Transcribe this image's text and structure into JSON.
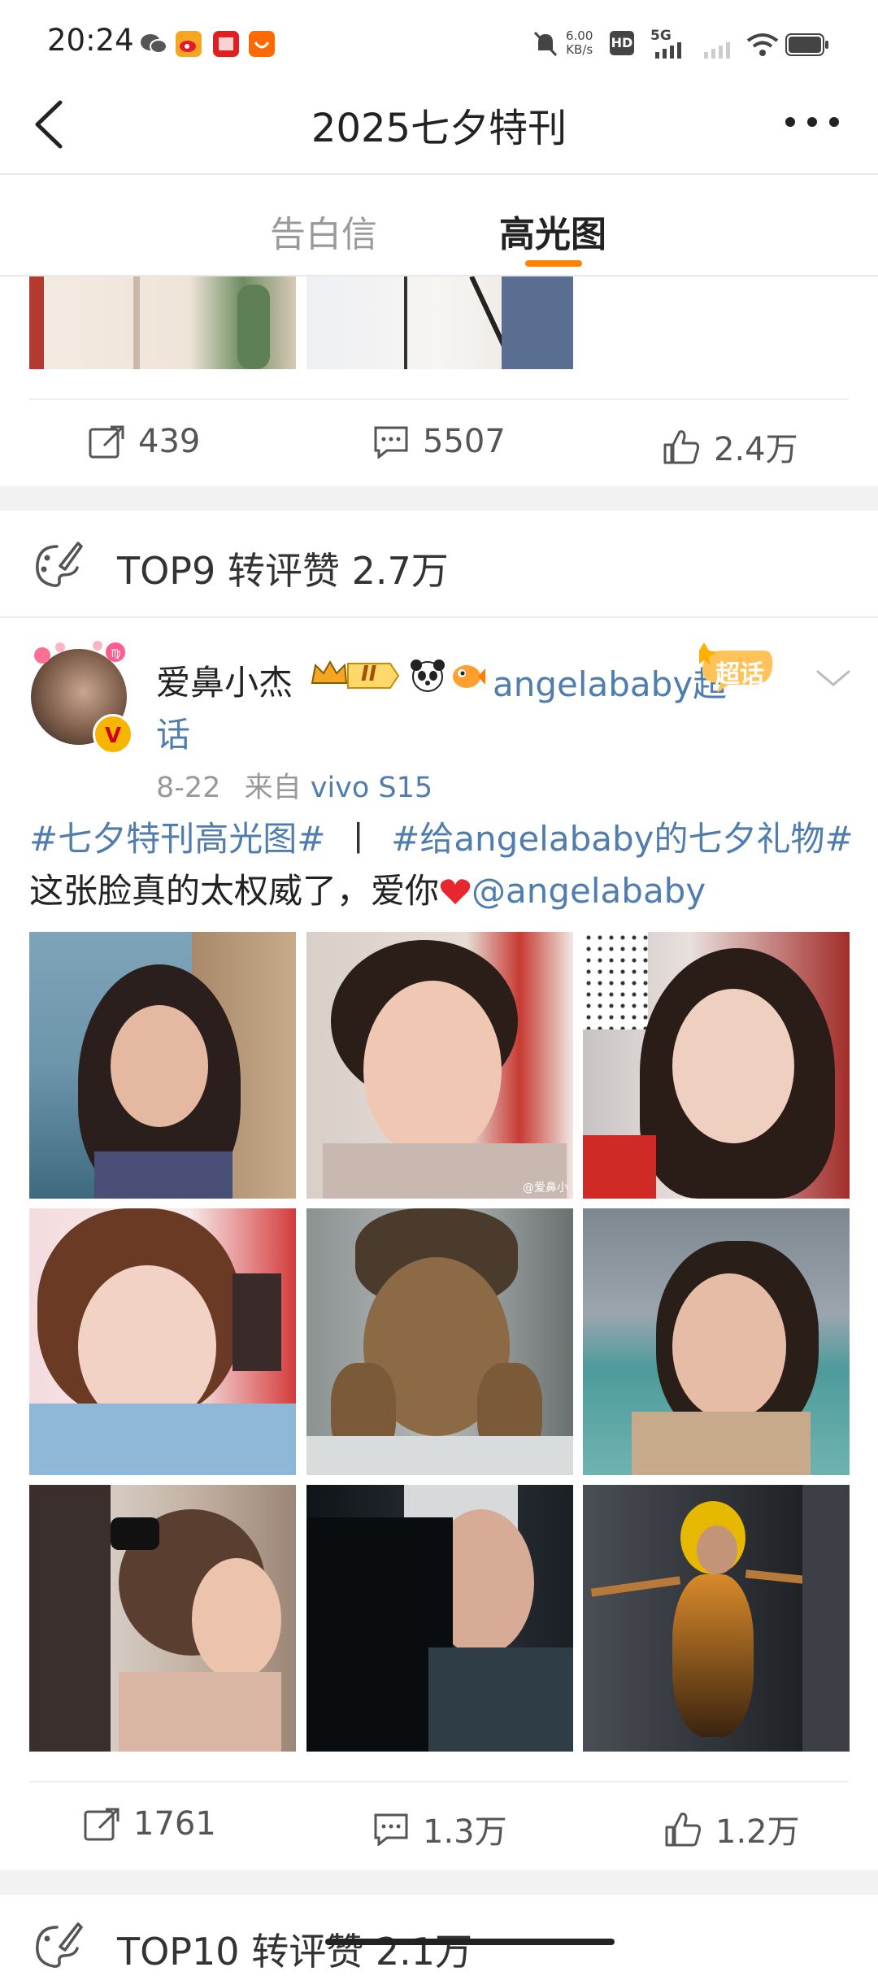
{
  "status_bar": {
    "time": "20:24",
    "net_speed_top": "6.00",
    "net_speed_bottom": "KB/s",
    "hd_label": "HD",
    "signal_label": "5G"
  },
  "nav": {
    "title": "2025七夕特刊"
  },
  "tabs": [
    {
      "label": "告白信"
    },
    {
      "label": "高光图"
    }
  ],
  "prev_post": {
    "reposts": "439",
    "comments": "5507",
    "likes": "2.4万"
  },
  "rank_header": {
    "rank": "TOP9",
    "label": "转评赞",
    "value": "2.7万"
  },
  "post": {
    "username": "爱鼻小杰",
    "badge_level": "II",
    "super_topic_prefix": "angelababy超",
    "super_topic_suffix": "话",
    "super_topic_tag": "超话",
    "date": "8-22",
    "source_prefix": "来自",
    "source": "vivo S15",
    "text_hashtag1": "#七夕特刊高光图#",
    "text_sep": "丨",
    "text_hashtag2": "#给angelababy的七夕礼物#",
    "text_body": "这张脸真的太权威了，爱你",
    "text_mention": "@angelababy",
    "watermark": "@爱鼻小",
    "reposts": "1761",
    "comments": "1.3万",
    "likes": "1.2万"
  },
  "next_rank_header": {
    "rank": "TOP10",
    "label": "转评赞",
    "value": "2.1万"
  },
  "colors": {
    "accent": "#ff8200",
    "link": "#507daf",
    "like_heart": "#e8262d"
  }
}
